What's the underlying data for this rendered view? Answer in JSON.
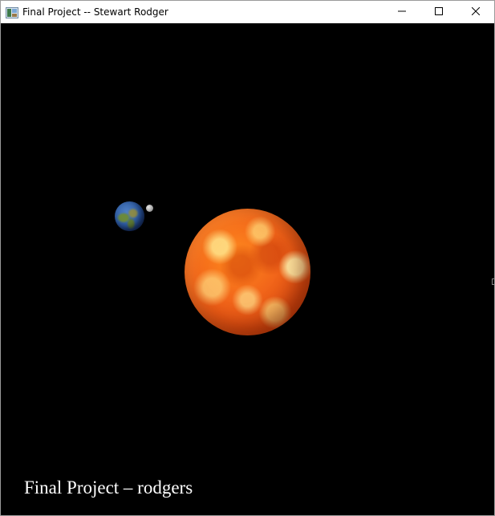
{
  "window": {
    "title": "Final Project -- Stewart Rodger",
    "minimize_glyph": "—",
    "maximize_glyph": "☐",
    "close_glyph": "✕",
    "app_icon": "window-app-icon"
  },
  "scene": {
    "background_color": "#000000",
    "objects": {
      "sun": "sun-sphere",
      "earth": "earth-sphere",
      "moon": "moon-sphere"
    },
    "caption": "Final Project – rodgers"
  }
}
